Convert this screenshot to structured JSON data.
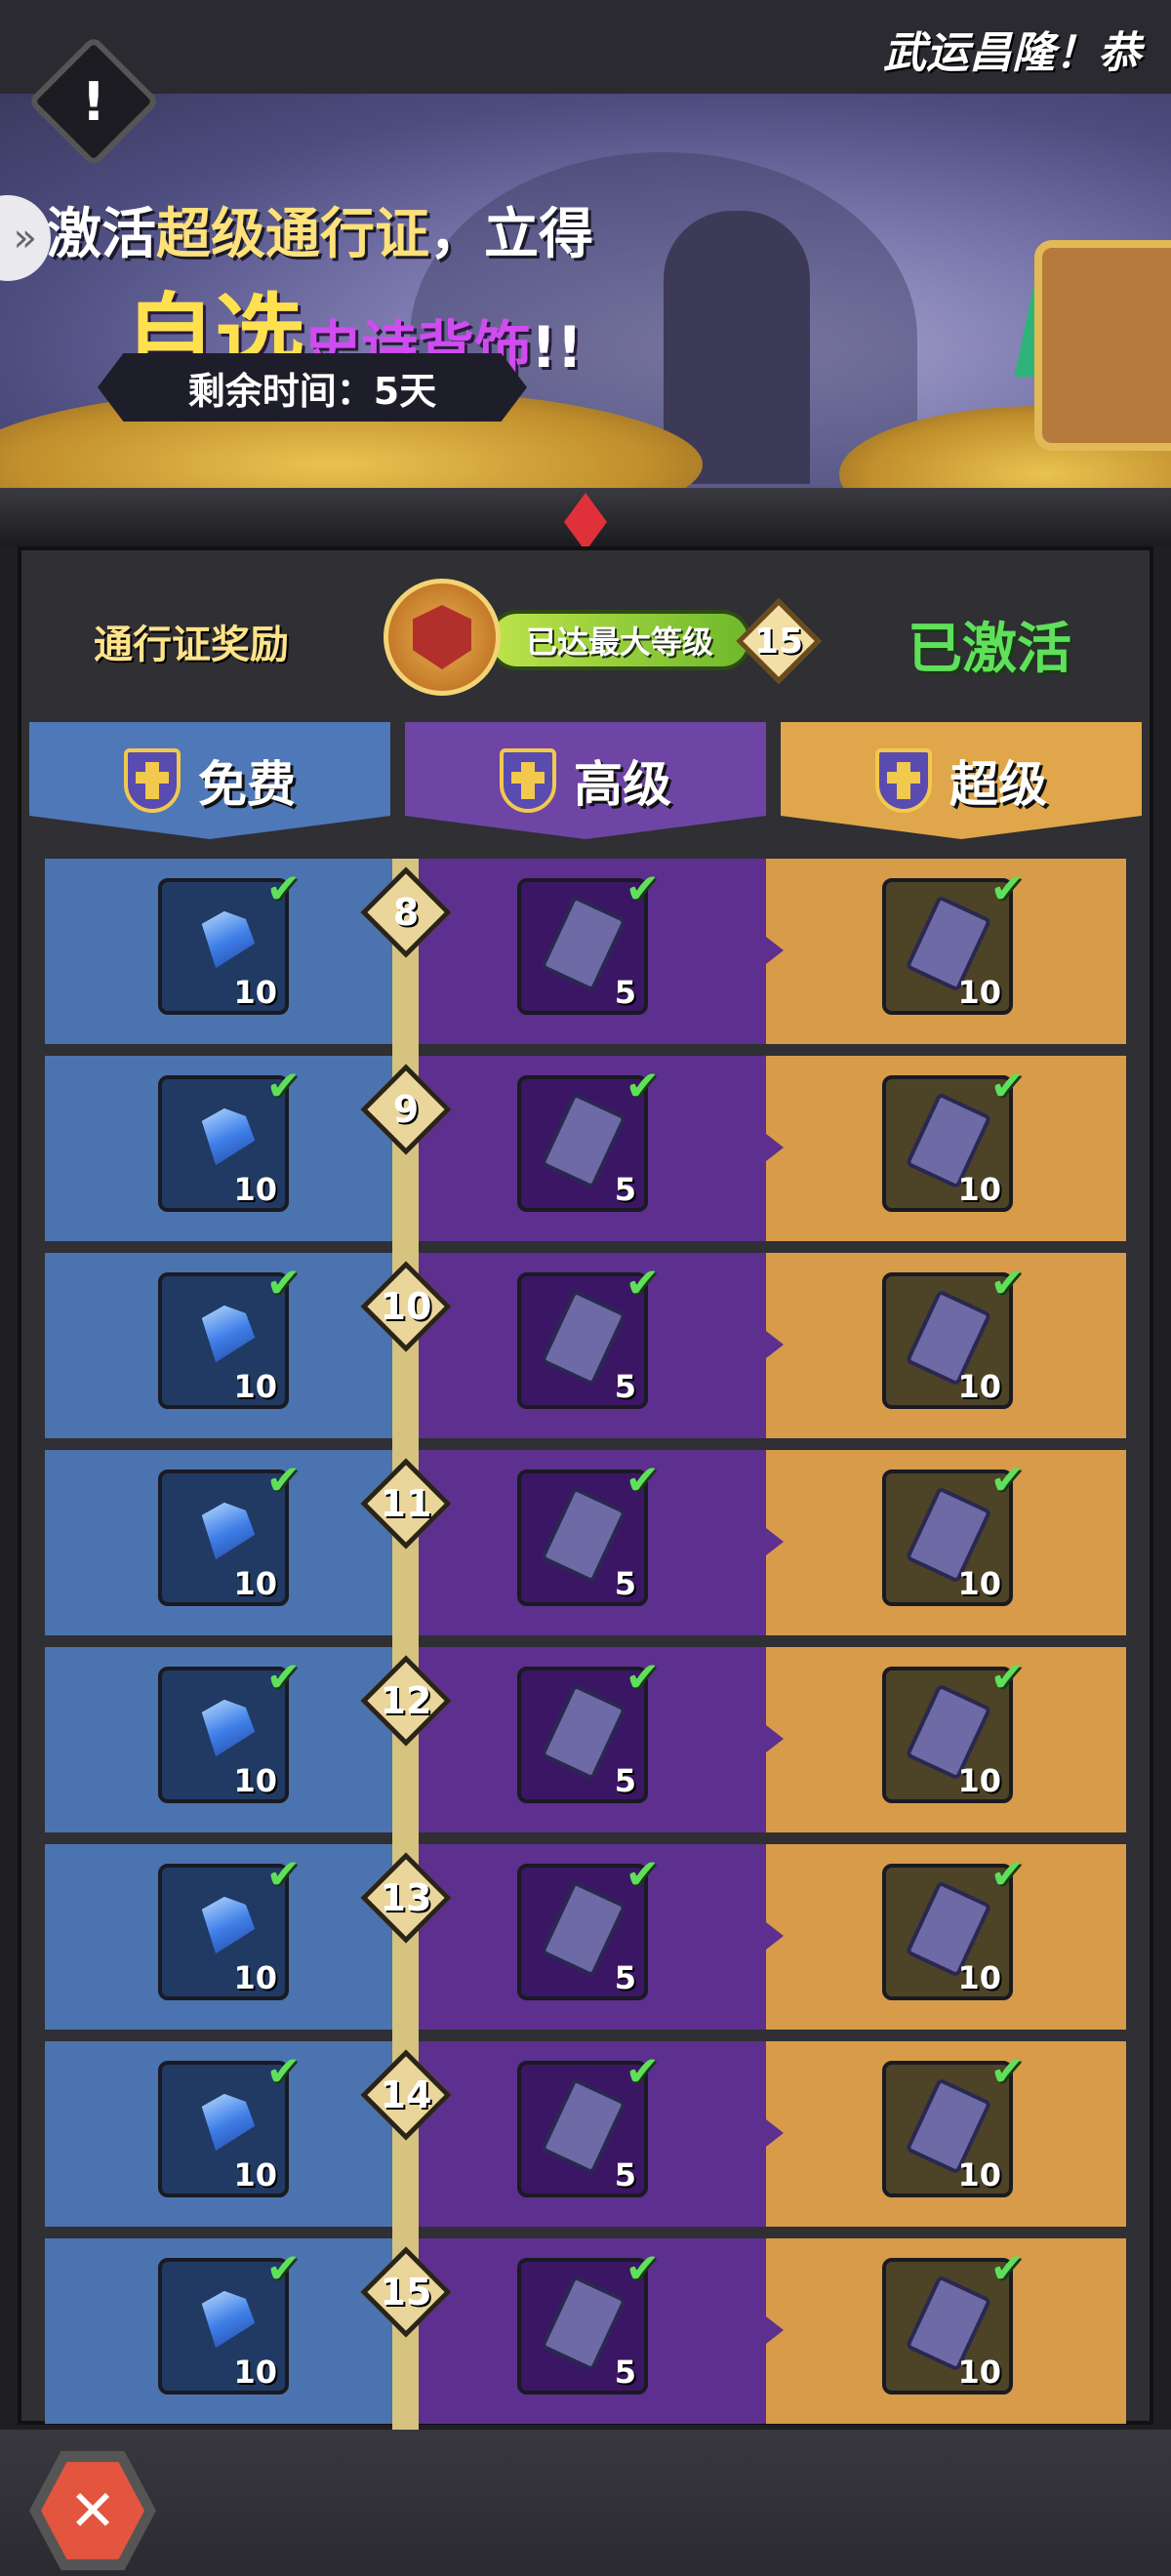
{
  "marquee": {
    "text": "武运昌隆！恭"
  },
  "alert_icon": "!",
  "banner": {
    "line1_a": "激活",
    "line1_hl": "超级通行证",
    "line1_b": "，立得",
    "line2_big": "自选",
    "line2_purple": "史诗背饰",
    "line2_excl": "!!",
    "timer": "剩余时间：5天"
  },
  "header": {
    "pass_rewards_label": "通行证奖励",
    "max_level_text": "已达最大等级",
    "current_level": "15",
    "status": "已激活"
  },
  "tabs": {
    "free": "免费",
    "advanced": "高级",
    "super": "超级"
  },
  "rows": [
    {
      "level": "8",
      "free_qty": "10",
      "adv_qty": "5",
      "super_qty": "10"
    },
    {
      "level": "9",
      "free_qty": "10",
      "adv_qty": "5",
      "super_qty": "10"
    },
    {
      "level": "10",
      "free_qty": "10",
      "adv_qty": "5",
      "super_qty": "10"
    },
    {
      "level": "11",
      "free_qty": "10",
      "adv_qty": "5",
      "super_qty": "10"
    },
    {
      "level": "12",
      "free_qty": "10",
      "adv_qty": "5",
      "super_qty": "10"
    },
    {
      "level": "13",
      "free_qty": "10",
      "adv_qty": "5",
      "super_qty": "10"
    },
    {
      "level": "14",
      "free_qty": "10",
      "adv_qty": "5",
      "super_qty": "10"
    },
    {
      "level": "15",
      "free_qty": "10",
      "adv_qty": "5",
      "super_qty": "10"
    }
  ],
  "icons": {
    "free_reward": "gem-icon",
    "adv_reward": "ticket-icon",
    "super_reward": "ticket-icon",
    "claimed": "checkmark-icon",
    "close": "crossed-swords-icon"
  },
  "colors": {
    "free": "#4b73b0",
    "advanced": "#5d2f8e",
    "super": "#d79b49",
    "activated": "#5fe05a"
  }
}
